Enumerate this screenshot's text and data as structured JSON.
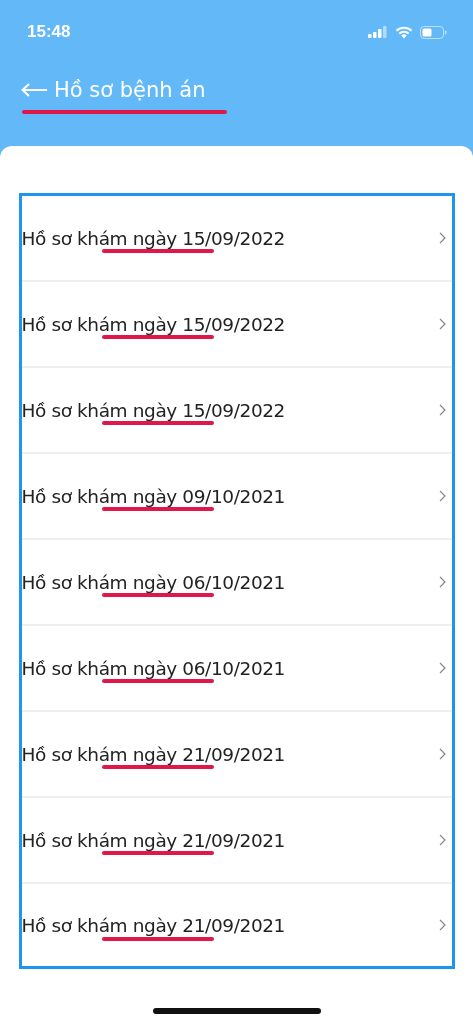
{
  "status_bar": {
    "time": "15:48"
  },
  "header": {
    "title": "Hồ sơ bệnh án"
  },
  "records": [
    {
      "label": "Hồ sơ khám ngày 15/09/2022"
    },
    {
      "label": "Hồ sơ khám ngày 15/09/2022"
    },
    {
      "label": "Hồ sơ khám ngày 15/09/2022"
    },
    {
      "label": "Hồ sơ khám ngày 09/10/2021"
    },
    {
      "label": "Hồ sơ khám ngày 06/10/2021"
    },
    {
      "label": "Hồ sơ khám ngày 06/10/2021"
    },
    {
      "label": "Hồ sơ khám ngày 21/09/2021"
    },
    {
      "label": "Hồ sơ khám ngày 21/09/2021"
    },
    {
      "label": "Hồ sơ khám ngày 21/09/2021"
    }
  ]
}
